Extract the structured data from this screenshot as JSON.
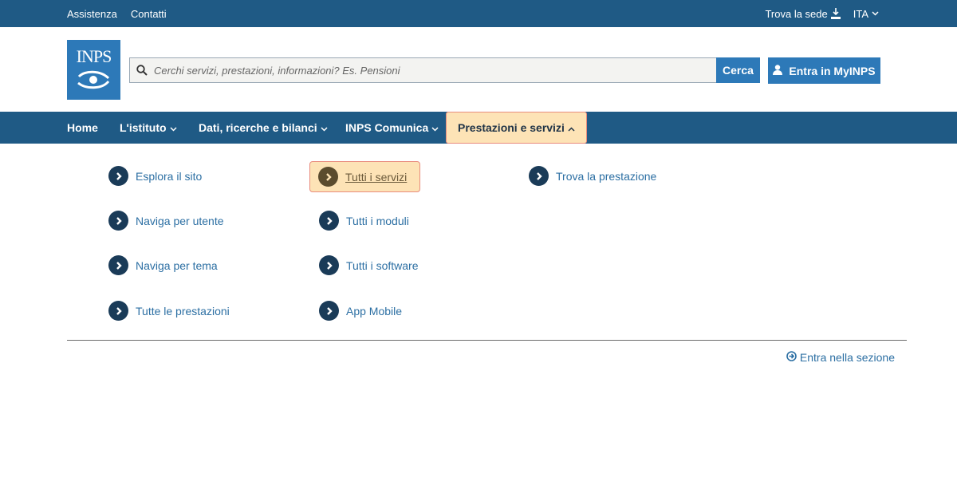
{
  "topbar": {
    "assistenza": "Assistenza",
    "contatti": "Contatti",
    "trova_sede": "Trova la sede",
    "lang": "ITA"
  },
  "logo": {
    "text": "INPS"
  },
  "search": {
    "placeholder": "Cerchi servizi, prestazioni, informazioni? Es. Pensioni",
    "button": "Cerca"
  },
  "myinps": {
    "label": "Entra in MyINPS"
  },
  "nav": {
    "home": "Home",
    "istituto": "L'istituto",
    "dati": "Dati, ricerche e bilanci",
    "comunica": "INPS Comunica",
    "prestazioni": "Prestazioni e servizi"
  },
  "menu": {
    "col1": [
      "Esplora il sito",
      "Naviga per utente",
      "Naviga per tema",
      "Tutte le prestazioni"
    ],
    "col2": [
      "Tutti i servizi",
      "Tutti i moduli",
      "Tutti i software",
      "App Mobile"
    ],
    "col3": [
      "Trova la prestazione"
    ]
  },
  "enter_section": "Entra nella sezione",
  "colors": {
    "bar": "#1f5a85",
    "accent": "#2d79b8",
    "highlight": "#fde3b6",
    "highlight_border": "#e98c7d",
    "link": "#2c6fa3",
    "bullet": "#1a3b58"
  },
  "icons": {
    "trova_sede": "map-pin-download-icon",
    "search": "search-icon",
    "user": "user-icon",
    "chevron": "chevron-right-circle-icon",
    "enter": "arrow-right-circle-icon"
  }
}
